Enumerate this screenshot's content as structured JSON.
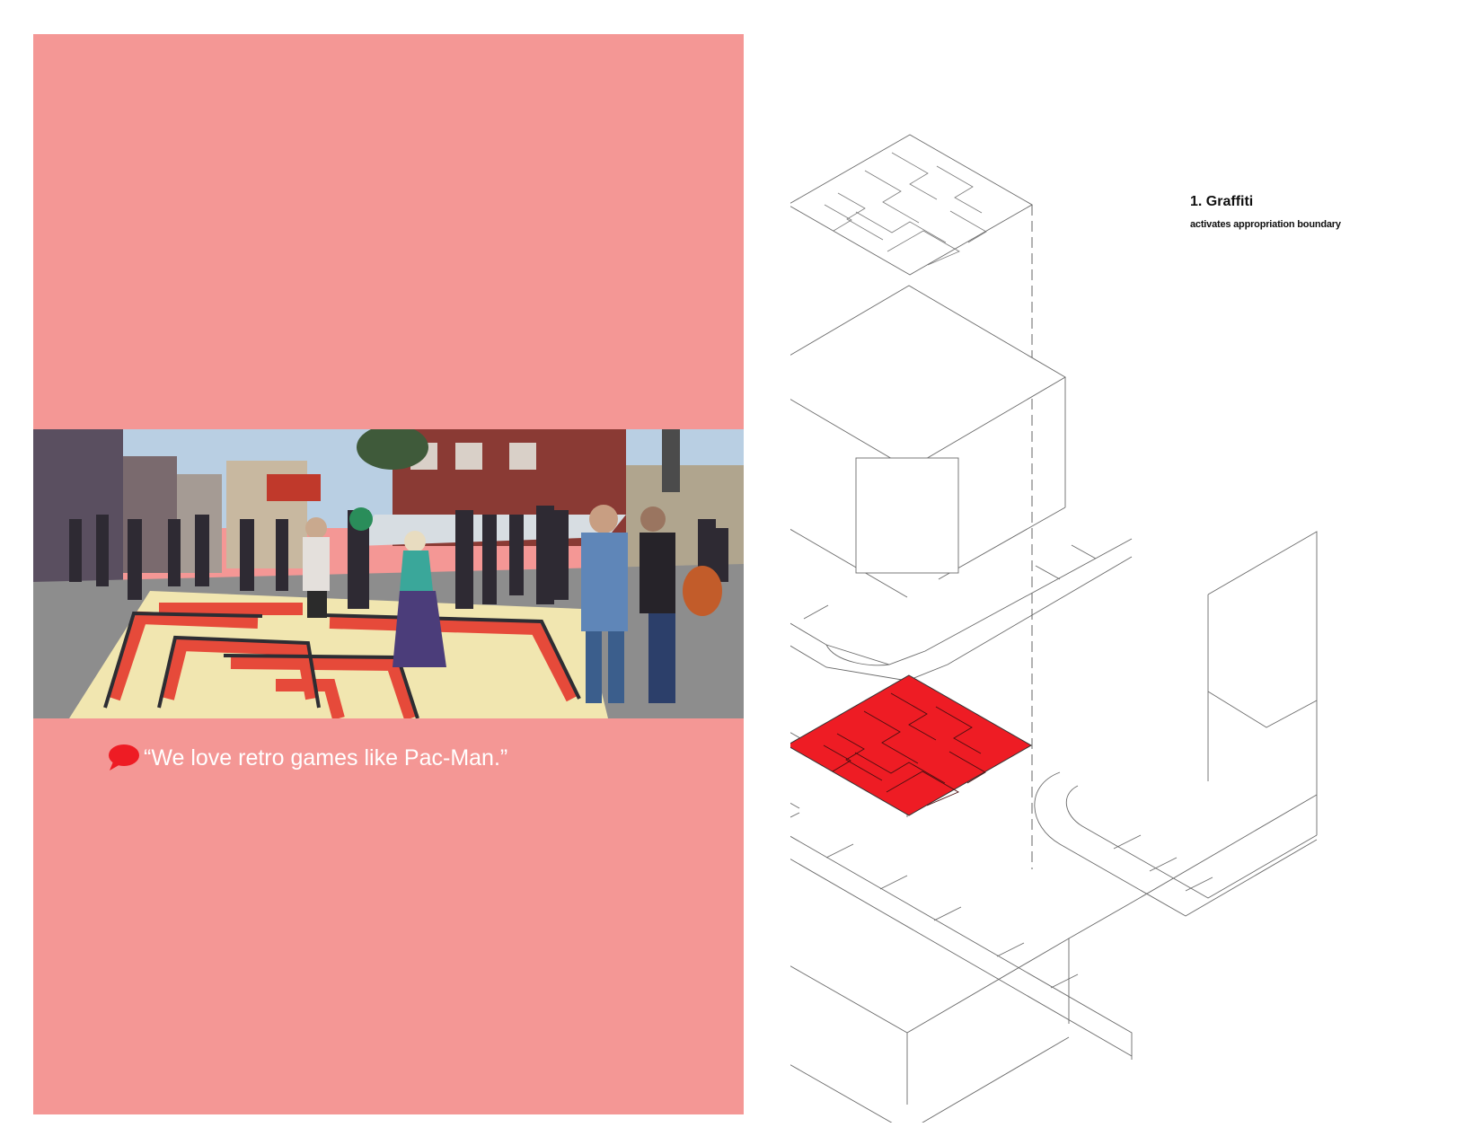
{
  "left": {
    "panel_color": "#f49795",
    "photo": {
      "subject": "street-crowd-pacman-mural"
    },
    "quote": {
      "icon": "speech-bubble-icon",
      "text": "“We love retro games like Pac-Man.”"
    }
  },
  "diagram": {
    "accent_color": "#ee1c24",
    "label": {
      "title": "1. Graffiti",
      "subtitle": "activates appropriation boundary"
    }
  }
}
